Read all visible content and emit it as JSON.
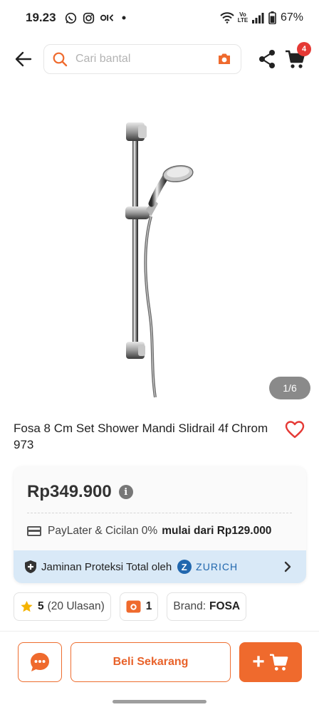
{
  "status_bar": {
    "time": "19.23",
    "battery": "67%",
    "icons": [
      "whatsapp-icon",
      "instagram-icon",
      "ola-icon",
      "dot-icon",
      "wifi-icon",
      "volte-icon",
      "signal-icon",
      "battery-icon"
    ],
    "volte_label": "Vo LTE"
  },
  "nav": {
    "search_placeholder": "Cari bantal",
    "cart_count": "4"
  },
  "product": {
    "image_counter": "1/6",
    "title": "Fosa 8 Cm Set Shower Mandi Slidrail 4f Chrom 973",
    "price": "Rp349.900",
    "info_label": "i",
    "paylater_label": "PayLater & Cicilan 0%",
    "paylater_value": "mulai dari Rp129.000",
    "protection_text": "Jaminan Proteksi Total oleh",
    "protection_brand": "ZURICH",
    "protection_brand_letter": "Z"
  },
  "chips": {
    "rating": "5",
    "reviews": "(20 Ulasan)",
    "photo_count": "1",
    "brand_label": "Brand:",
    "brand_value": "FOSA"
  },
  "bottom_bar": {
    "buy_now_label": "Beli Sekarang",
    "add_to_cart_symbol": "+"
  },
  "colors": {
    "accent": "#ef6a2d",
    "badge": "#e53935",
    "zurich_blue": "#2167ae",
    "protection_bg": "#d9e9f7",
    "star": "#f5b301"
  }
}
